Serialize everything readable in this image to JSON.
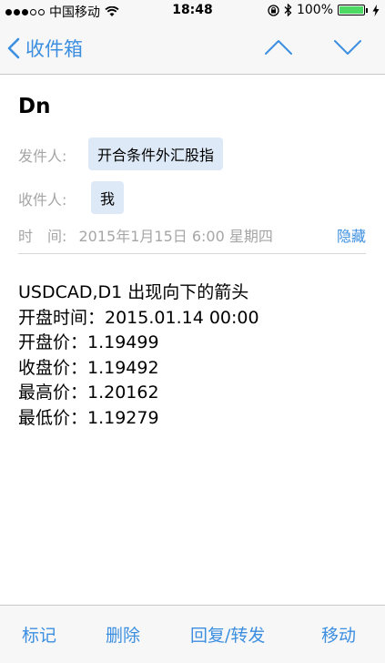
{
  "status_bar": {
    "carrier": "中国移动",
    "time": "18:48",
    "battery": "100%"
  },
  "nav": {
    "back_label": "收件箱"
  },
  "email": {
    "subject": "Dn",
    "from_label": "发件人:",
    "from_value": "开合条件外汇股指",
    "to_label": "收件人:",
    "to_value": "我",
    "time_label": "时　间:",
    "time_value": "2015年1月15日 6:00 星期四",
    "hide_label": "隐藏",
    "body_lines": [
      "USDCAD,D1 出现向下的箭头",
      "开盘时间：2015.01.14 00:00",
      "开盘价：1.19499",
      "收盘价：1.19492",
      "最高价：1.20162",
      "最低价：1.19279"
    ]
  },
  "toolbar": {
    "mark": "标记",
    "delete": "删除",
    "reply_forward": "回复/转发",
    "move": "移动"
  },
  "colors": {
    "accent": "#3c8fe0",
    "chip_bg": "#dde9f7",
    "muted_text": "#a6a6a6",
    "battery_green": "#4cd964"
  }
}
